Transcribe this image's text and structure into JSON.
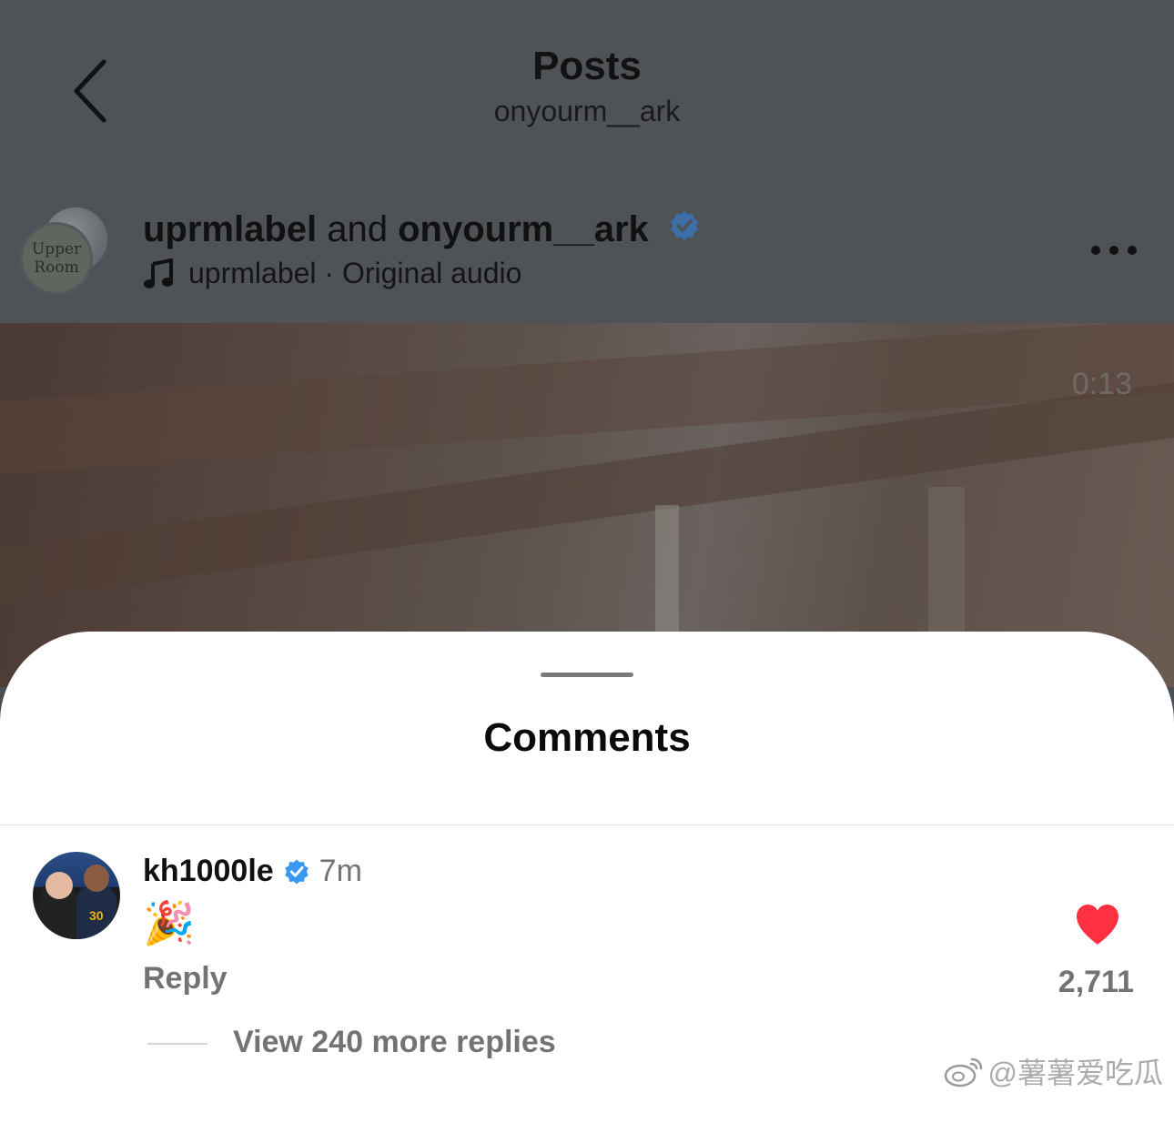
{
  "header": {
    "title": "Posts",
    "subtitle": "onyourm__ark"
  },
  "post": {
    "author_primary": "uprmlabel",
    "author_joiner": " and ",
    "author_secondary": "onyourm__ark",
    "audio_text": "uprmlabel · Original audio",
    "avatar_logo_line1": "Upper",
    "avatar_logo_line2": "Room",
    "video_timestamp": "0:13"
  },
  "comments_sheet": {
    "title": "Comments",
    "comment": {
      "username": "kh1000le",
      "time": "7m",
      "text": "🎉",
      "reply_label": "Reply",
      "like_count": "2,711",
      "view_replies": "View 240 more replies",
      "avatar_jersey": "30"
    }
  },
  "watermark": {
    "text": "@薯薯爱吃瓜"
  },
  "colors": {
    "verified": "#3897f0",
    "heart": "#ff3040",
    "muted_text": "#737373"
  },
  "icons": [
    "back-icon",
    "verified-icon",
    "music-icon",
    "more-icon",
    "heart-icon",
    "weibo-icon"
  ]
}
